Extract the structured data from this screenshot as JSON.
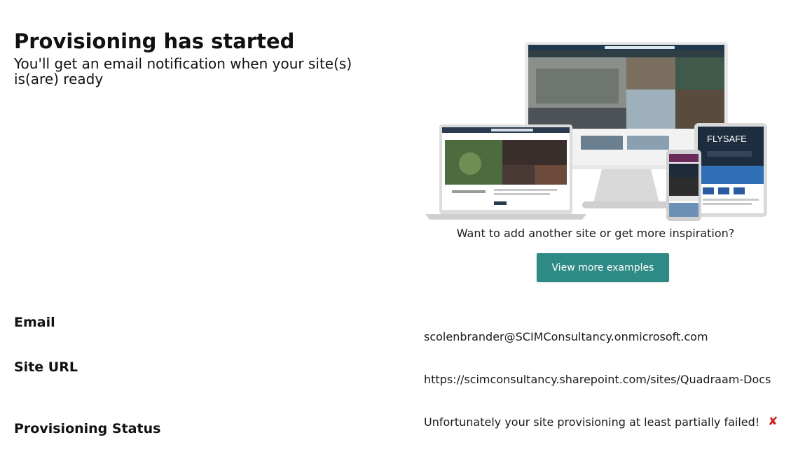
{
  "header": {
    "title": "Provisioning has started",
    "subtitle": "You'll get an email notification when your site(s) is(are) ready"
  },
  "promo": {
    "question": "Want to add another site or get more inspiration?",
    "button_label": "View more examples",
    "button_color": "#2e8a86",
    "hero_image": "sharepoint-devices-illustration",
    "tablet_brand": "FLYSAFE"
  },
  "details": {
    "email_label": "Email",
    "email_value": "scolenbrander@SCIMConsultancy.onmicrosoft.com",
    "site_url_label": "Site URL",
    "site_url_value": "https://scimconsultancy.sharepoint.com/sites/Quadraam-Docs",
    "status_label": "Provisioning Status",
    "status_value": "Unfortunately your site provisioning at least partially failed!",
    "status_icon": "error-x-icon",
    "status_color": "#cc1f1f"
  }
}
